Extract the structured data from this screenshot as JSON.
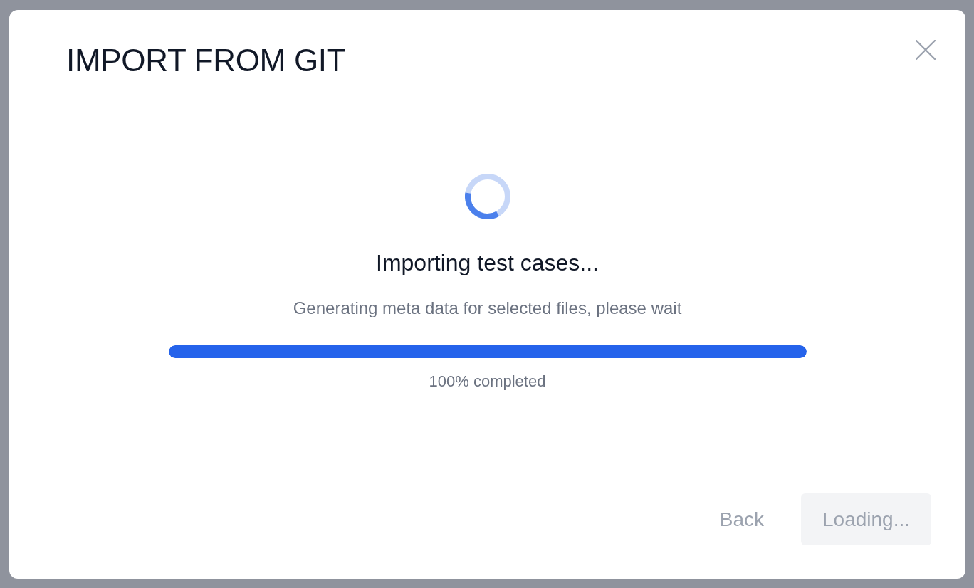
{
  "dialog": {
    "title": "IMPORT FROM GIT",
    "progress": {
      "heading": "Importing test cases...",
      "message": "Generating meta data for selected files, please wait",
      "level": 1.0,
      "reading": "100% completed"
    },
    "buttons": [
      {
        "label": "Back",
        "kind": "text",
        "disabled": true
      },
      {
        "label": "Loading...",
        "kind": "filled",
        "disabled": true
      }
    ]
  }
}
